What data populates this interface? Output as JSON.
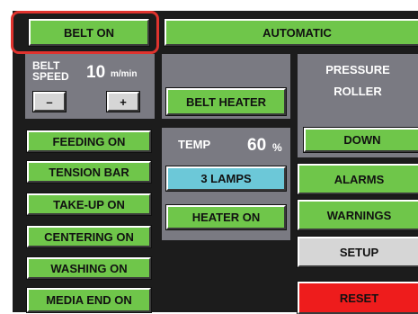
{
  "top_bar": {
    "belt_on_label": "BELT ON",
    "automatic_label": "AUTOMATIC"
  },
  "belt_speed": {
    "label_line1": "BELT",
    "label_line2": "SPEED",
    "value": "10",
    "unit": "m/min",
    "minus_label": "–",
    "plus_label": "+"
  },
  "left_buttons": [
    {
      "label": "FEEDING ON"
    },
    {
      "label": "TENSION BAR"
    },
    {
      "label": "TAKE-UP ON"
    },
    {
      "label": "CENTERING ON"
    },
    {
      "label": "WASHING ON"
    },
    {
      "label": "MEDIA END ON"
    }
  ],
  "heater": {
    "belt_heater_label": "BELT HEATER",
    "temp_label": "TEMP",
    "temp_value": "60",
    "temp_unit": "%",
    "lamps_label": "3 LAMPS",
    "heater_on_label": "HEATER ON"
  },
  "pressure_roller": {
    "title_line1": "PRESSURE",
    "title_line2": "ROLLER",
    "down_label": "DOWN"
  },
  "right_buttons": {
    "alarms_label": "ALARMS",
    "warnings_label": "WARNINGS",
    "setup_label": "SETUP",
    "reset_label": "RESET"
  },
  "colors": {
    "active_green": "#6fc64a",
    "selected_cyan": "#6cc8d8",
    "neutral_gray": "#d6d6d6",
    "reset_red": "#ee1c1c",
    "panel_gray": "#7a7a82",
    "highlight_red": "#e0332e"
  }
}
